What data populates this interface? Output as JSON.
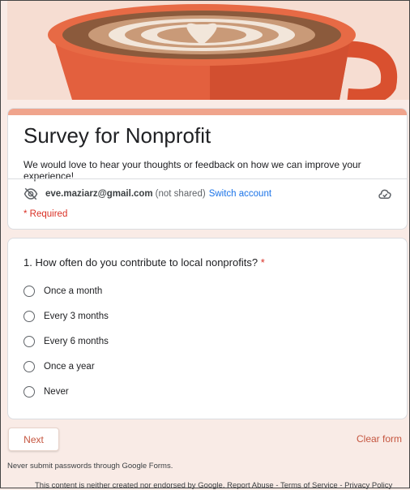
{
  "form": {
    "title": "Survey for Nonprofit",
    "description": "We would love to hear your thoughts or feedback on how we can improve your experience!"
  },
  "account": {
    "email": "eve.maziarz@gmail.com",
    "not_shared": "(not shared)",
    "switch_label": "Switch account",
    "hidden_icon": "eye-off-icon",
    "cloud_icon": "cloud-icon"
  },
  "required_note": "* Required",
  "question": {
    "label": "1. How often do you contribute to local nonprofits?",
    "required_mark": "*",
    "options": [
      "Once a month",
      "Every 3 months",
      "Every 6 months",
      "Once a year",
      "Never"
    ]
  },
  "actions": {
    "next": "Next",
    "clear": "Clear form"
  },
  "footer": {
    "warning": "Never submit passwords through Google Forms.",
    "disclaimer": "This content is neither created nor endorsed by Google. Report Abuse - Terms of Service - Privacy Policy"
  },
  "colors": {
    "accent": "#c5553f",
    "link": "#1a73e8",
    "required": "#d93025",
    "background": "#f9ebe6"
  }
}
